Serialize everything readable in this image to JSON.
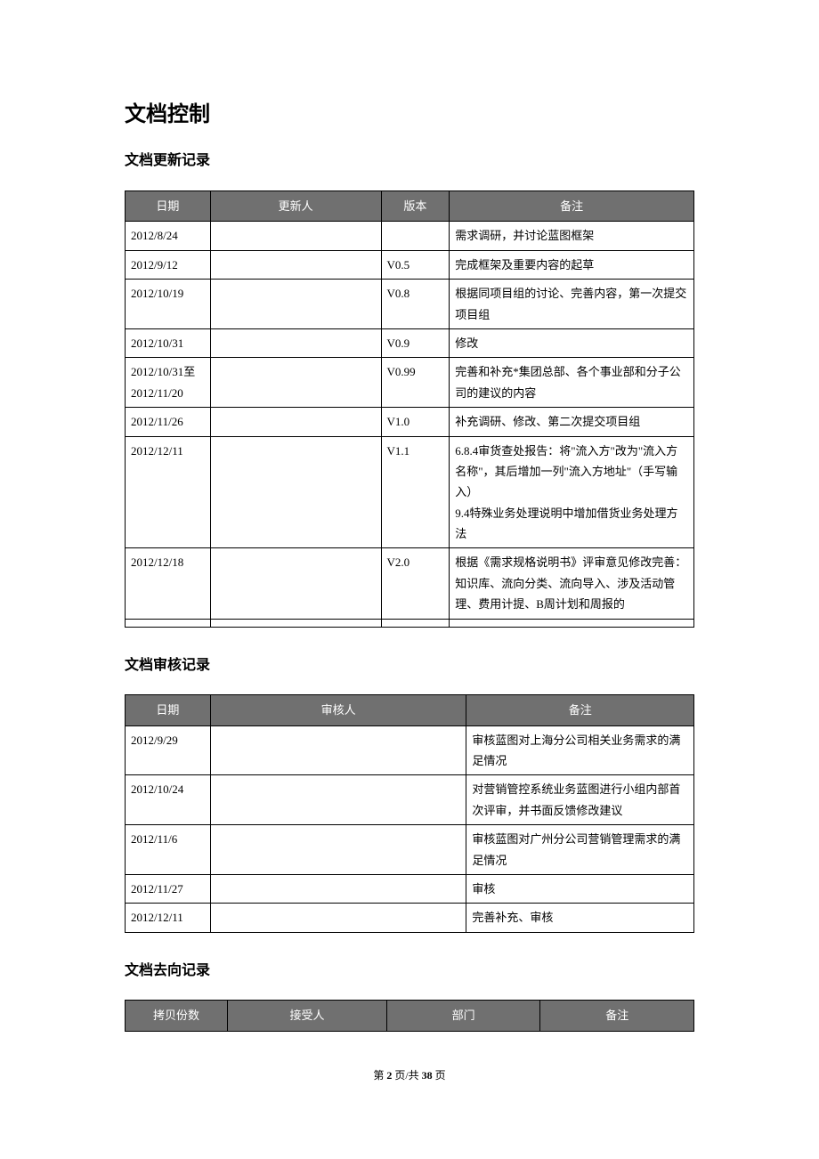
{
  "title": "文档控制",
  "sections": {
    "update": {
      "heading": "文档更新记录",
      "headers": [
        "日期",
        "更新人",
        "版本",
        "备注"
      ],
      "rows": [
        {
          "date": "2012/8/24",
          "updater": "",
          "version": "",
          "remark": "需求调研，并讨论蓝图框架"
        },
        {
          "date": "2012/9/12",
          "updater": "",
          "version": "V0.5",
          "remark": "完成框架及重要内容的起草"
        },
        {
          "date": "2012/10/19",
          "updater": "",
          "version": "V0.8",
          "remark": "根据同项目组的讨论、完善内容，第一次提交项目组"
        },
        {
          "date": "2012/10/31",
          "updater": "",
          "version": "V0.9",
          "remark": "修改"
        },
        {
          "date": "2012/10/31至2012/11/20",
          "updater": "",
          "version": "V0.99",
          "remark": "完善和补充*集团总部、各个事业部和分子公司的建议的内容"
        },
        {
          "date": "2012/11/26",
          "updater": "",
          "version": "V1.0",
          "remark": "补充调研、修改、第二次提交项目组"
        },
        {
          "date": "2012/12/11",
          "updater": "",
          "version": "V1.1",
          "remark": "6.8.4审货查处报告：将\"流入方\"改为\"流入方名称\"，其后增加一列\"流入方地址\"（手写输入）\n9.4特殊业务处理说明中增加借货业务处理方法"
        },
        {
          "date": "2012/12/18",
          "updater": "",
          "version": "V2.0",
          "remark": "根据《需求规格说明书》评审意见修改完善：知识库、流向分类、流向导入、涉及活动管理、费用计提、B周计划和周报的"
        },
        {
          "date": "",
          "updater": "",
          "version": "",
          "remark": ""
        }
      ]
    },
    "review": {
      "heading": "文档审核记录",
      "headers": [
        "日期",
        "审核人",
        "备注"
      ],
      "rows": [
        {
          "date": "2012/9/29",
          "reviewer": "",
          "remark": "审核蓝图对上海分公司相关业务需求的满足情况"
        },
        {
          "date": "2012/10/24",
          "reviewer": "",
          "remark": "对营销管控系统业务蓝图进行小组内部首次评审，并书面反馈修改建议"
        },
        {
          "date": "2012/11/6",
          "reviewer": "",
          "remark": "审核蓝图对广州分公司营销管理需求的满足情况"
        },
        {
          "date": "2012/11/27",
          "reviewer": "",
          "remark": "审核"
        },
        {
          "date": "2012/12/11",
          "reviewer": "",
          "remark": "完善补充、审核"
        }
      ]
    },
    "distribution": {
      "heading": "文档去向记录",
      "headers": [
        "拷贝份数",
        "接受人",
        "部门",
        "备注"
      ]
    }
  },
  "footer": {
    "prefix": "第 ",
    "current": "2",
    "middle": " 页/共 ",
    "total": "38",
    "suffix": " 页"
  }
}
